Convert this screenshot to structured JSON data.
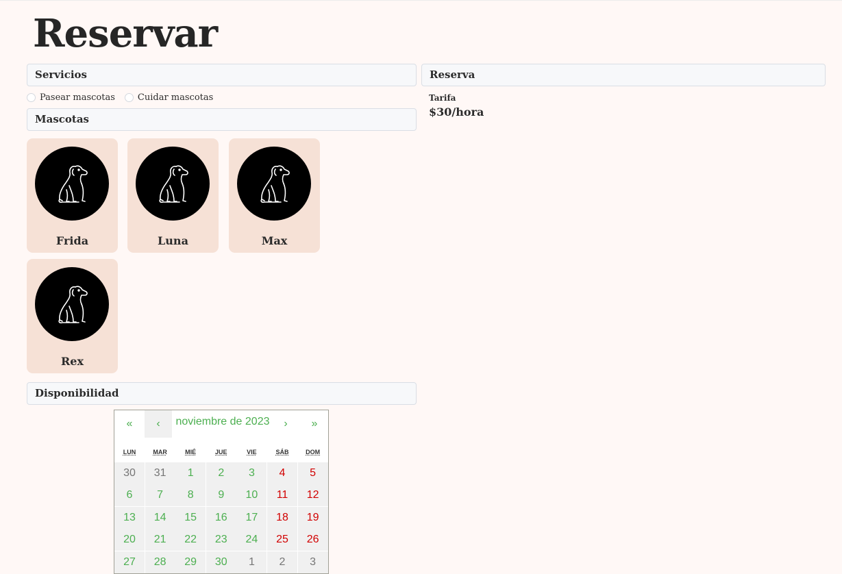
{
  "page": {
    "title": "Reservar"
  },
  "sections": {
    "services": "Servicios",
    "pets": "Mascotas",
    "availability": "Disponibilidad",
    "booking": "Reserva"
  },
  "services": {
    "options": [
      "Pasear mascotas",
      "Cuidar mascotas"
    ]
  },
  "pets": [
    {
      "name": "Frida",
      "icon": "dog-icon"
    },
    {
      "name": "Luna",
      "icon": "dog-icon"
    },
    {
      "name": "Max",
      "icon": "dog-icon"
    },
    {
      "name": "Rex",
      "icon": "dog-icon"
    }
  ],
  "booking": {
    "rate_label": "Tarifa",
    "rate_value": "$30/hora"
  },
  "calendar": {
    "month_label": "noviembre de 2023",
    "nav": {
      "prev_year": "«",
      "prev_month": "‹",
      "next_month": "›",
      "next_year": "»"
    },
    "weekdays": [
      "LUN",
      "MAR",
      "MIÉ",
      "JUE",
      "VIE",
      "SÁB",
      "DOM"
    ],
    "weeks": [
      [
        "30",
        "31",
        "1",
        "2",
        "3",
        "4",
        "5"
      ],
      [
        "6",
        "7",
        "8",
        "9",
        "10",
        "11",
        "12"
      ],
      [
        "13",
        "14",
        "15",
        "16",
        "17",
        "18",
        "19"
      ],
      [
        "20",
        "21",
        "22",
        "23",
        "24",
        "25",
        "26"
      ],
      [
        "27",
        "28",
        "29",
        "30",
        "1",
        "2",
        "3"
      ]
    ],
    "colors": {
      "current_weekday": "#4caf50",
      "weekend": "#d10000",
      "other_month": "#757575"
    }
  }
}
